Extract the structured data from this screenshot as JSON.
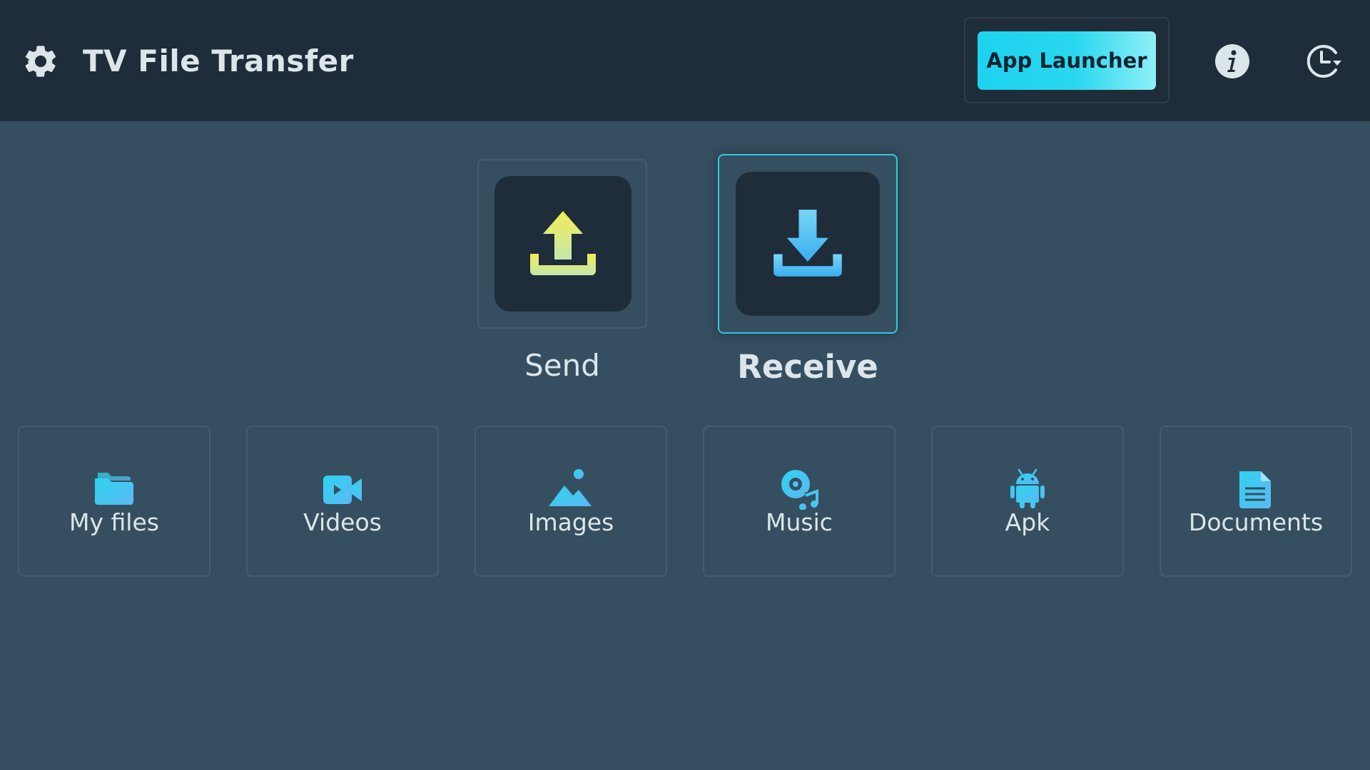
{
  "header": {
    "title": "TV File Transfer",
    "settings_icon": "gear-icon",
    "app_launcher_label": "App Launcher",
    "info_icon": "info-icon",
    "history_icon": "history-icon"
  },
  "actions": [
    {
      "label": "Send",
      "icon": "upload-icon",
      "focused": false
    },
    {
      "label": "Receive",
      "icon": "download-icon",
      "focused": true
    }
  ],
  "categories": [
    {
      "label": "My files",
      "icon": "folder-icon"
    },
    {
      "label": "Videos",
      "icon": "video-camera-icon"
    },
    {
      "label": "Images",
      "icon": "image-icon"
    },
    {
      "label": "Music",
      "icon": "music-icon"
    },
    {
      "label": "Apk",
      "icon": "android-icon"
    },
    {
      "label": "Documents",
      "icon": "document-icon"
    }
  ],
  "colors": {
    "background": "#354f61",
    "header_background": "#1f2d3a",
    "accent_cyan": "#1dd3ef",
    "send_gradient_start": "#f0eb5c",
    "send_gradient_end": "#c9e6a6",
    "receive_gradient_start": "#6fd0f5",
    "receive_gradient_end": "#3ab4f0"
  }
}
